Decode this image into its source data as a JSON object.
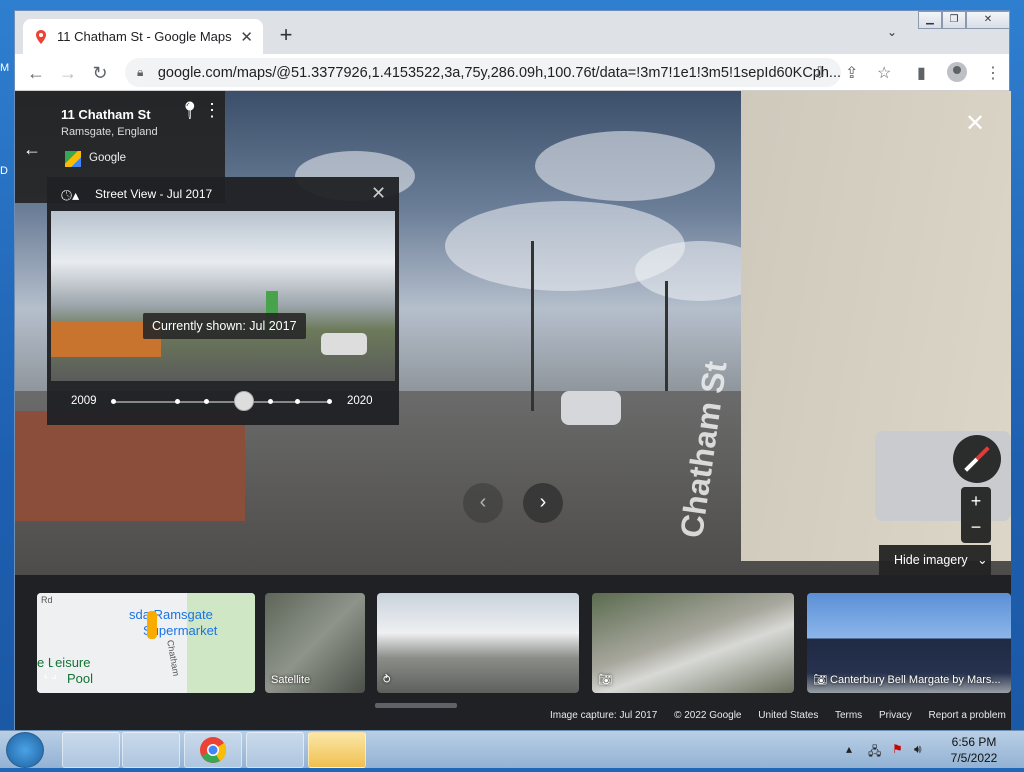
{
  "browser": {
    "tab_title": "11 Chatham St - Google Maps",
    "url": "google.com/maps/@51.3377926,1.4153522,3a,75y,286.09h,100.76t/data=!3m7!1e1!3m5!1sepId60KCph..."
  },
  "place": {
    "name": "11 Chatham St",
    "locality": "Ramsgate, England",
    "source": "Google"
  },
  "timeline": {
    "heading": "Street View - Jul 2017",
    "current_label": "Currently shown: Jul 2017",
    "start_year": "2009",
    "end_year": "2020",
    "selected_fraction": 0.6
  },
  "streetview": {
    "street_label": "Chatham St",
    "hide_imagery_label": "Hide imagery"
  },
  "cards": [
    {
      "label": "",
      "map_text_1": "sda Ramsgate",
      "map_text_2": "Supermarket",
      "map_text_3": "e Leisure",
      "map_text_4": "Pool",
      "map_text_5": "Chatham",
      "map_text_6": "Rd"
    },
    {
      "label": "Satellite"
    },
    {
      "label": ""
    },
    {
      "label": ""
    },
    {
      "label": "Canterbury Bell Margate by Mars..."
    }
  ],
  "footer": {
    "capture": "Image capture: Jul 2017",
    "copyright": "© 2022 Google",
    "region": "United States",
    "terms": "Terms",
    "privacy": "Privacy",
    "report": "Report a problem"
  },
  "taskbar": {
    "time": "6:56 PM",
    "date": "7/5/2022"
  },
  "colors": {
    "accent_red": "#ea4335",
    "panel_bg": "#202124"
  }
}
